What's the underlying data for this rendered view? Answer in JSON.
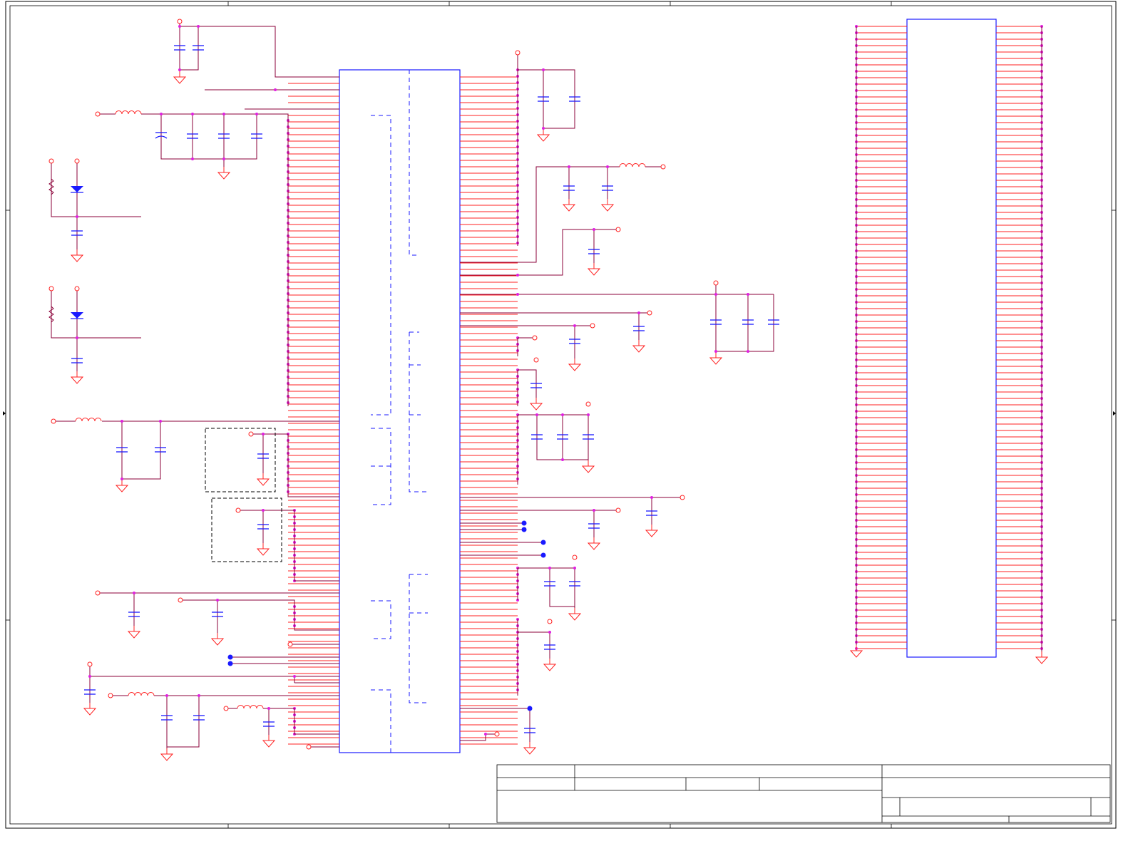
{
  "sheet": {
    "title": "",
    "title_block_texts": [],
    "colors": {
      "wire": "#8b0038",
      "pin": "#ff2020",
      "symbol": "#1a1aff",
      "junction": "#e020e0",
      "frame": "#000000",
      "keepout": "#000000",
      "port": "#ff2020",
      "noconnect": "#1a1aff"
    }
  },
  "components": {
    "main_ic": "ic",
    "connector": "connector",
    "capacitor_icon": "capacitor-icon",
    "inductor_icon": "inductor-icon",
    "ground_icon": "ground-icon",
    "led_icon": "led-icon",
    "resistor_icon": "resistor-icon"
  }
}
